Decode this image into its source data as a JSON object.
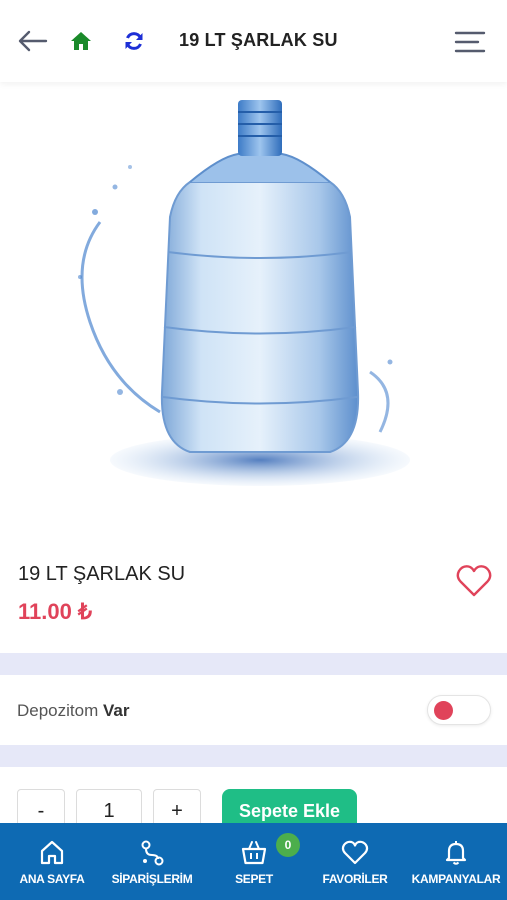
{
  "header": {
    "title": "19 LT ŞARLAK SU",
    "back_icon": "arrow-left-icon",
    "home_icon": "home-icon",
    "refresh_icon": "refresh-icon",
    "menu_icon": "hamburger-menu-icon"
  },
  "product": {
    "name": "19 LT ŞARLAK SU",
    "price": "11.00 ₺",
    "image": "water-bottle-19lt",
    "favorite_icon": "heart-outline-icon"
  },
  "deposit": {
    "label": "Depozitom",
    "value": "Var",
    "toggle_on": false
  },
  "quantity": {
    "minus_label": "-",
    "value": "1",
    "plus_label": "+"
  },
  "add_to_cart_label": "Sepete Ekle",
  "bottom_nav": {
    "items": [
      {
        "label": "ANA SAYFA",
        "icon": "home-outline-icon"
      },
      {
        "label": "SİPARİŞLERİM",
        "icon": "orders-icon"
      },
      {
        "label": "SEPET",
        "icon": "basket-icon",
        "badge": "0"
      },
      {
        "label": "FAVORİLER",
        "icon": "heart-icon"
      },
      {
        "label": "KAMPANYALAR",
        "icon": "bell-icon"
      }
    ]
  },
  "colors": {
    "accent_price": "#e0435a",
    "nav_bg": "#0e6ab3",
    "add_cart_bg": "#1fbe86",
    "badge_bg": "#4cae4c",
    "band_bg": "#e6e8f8"
  }
}
